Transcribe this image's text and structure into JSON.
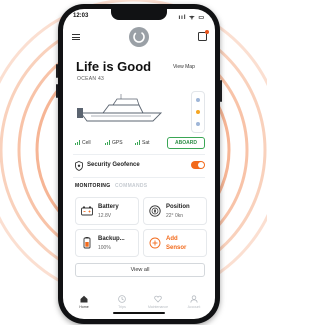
{
  "status": {
    "time": "12:03",
    "icons": "ııl ᯤ ▭"
  },
  "hero": {
    "title": "Life is Good",
    "subtitle": "OCEAN 43",
    "view_map": "View Map"
  },
  "connectivity": {
    "cell": "Cell",
    "gps": "GPS",
    "sat": "Sat",
    "aboard": "ABOARD"
  },
  "geofence": {
    "label": "Security Geofence",
    "enabled": true
  },
  "tabs": {
    "monitoring": "MONITORING",
    "commands": "COMMANDS"
  },
  "cards": {
    "battery": {
      "title": "Battery",
      "value": "12.8V"
    },
    "position": {
      "title": "Position",
      "value": "22° 0kn"
    },
    "backup": {
      "title": "Backup...",
      "value": "100%"
    },
    "add_sensor": {
      "line1": "Add",
      "line2": "Sensor"
    }
  },
  "view_all": "View all",
  "nav": [
    {
      "label": "Home",
      "icon": "home-icon",
      "active": true
    },
    {
      "label": "Trips",
      "icon": "clock-icon",
      "active": false
    },
    {
      "label": "Maintenance",
      "icon": "heart-icon",
      "active": false
    },
    {
      "label": "Account",
      "icon": "person-icon",
      "active": false
    }
  ],
  "colors": {
    "accent": "#f26a1b",
    "ok": "#3aa655",
    "ripple": "#f4a37a"
  }
}
